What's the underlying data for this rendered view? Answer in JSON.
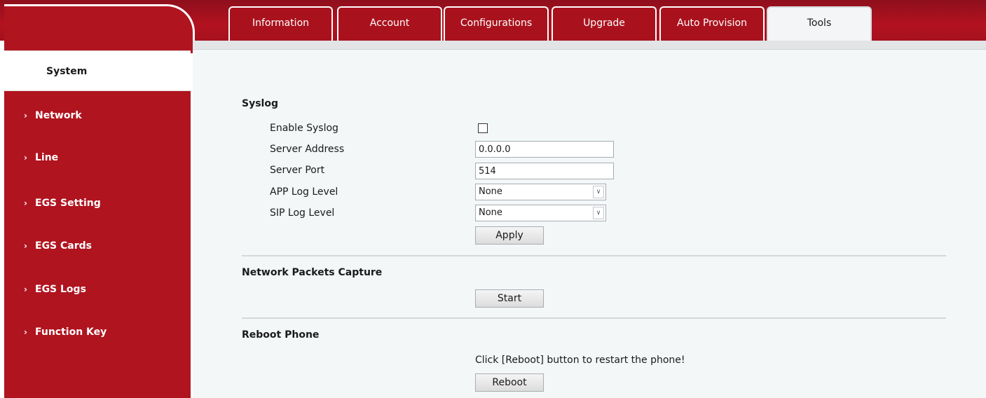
{
  "tabs": [
    {
      "label": "Information",
      "active": false
    },
    {
      "label": "Account",
      "active": false
    },
    {
      "label": "Configurations",
      "active": false
    },
    {
      "label": "Upgrade",
      "active": false
    },
    {
      "label": "Auto Provision",
      "active": false
    },
    {
      "label": "Tools",
      "active": true
    }
  ],
  "sidebar": {
    "active_item": "System",
    "items": [
      {
        "label": "Network",
        "icon": "chevron-right-icon"
      },
      {
        "label": "Line",
        "icon": "chevron-right-icon"
      },
      {
        "label": "EGS Setting",
        "icon": "chevron-right-icon"
      },
      {
        "label": "EGS Cards",
        "icon": "chevron-right-icon"
      },
      {
        "label": "EGS Logs",
        "icon": "chevron-right-icon"
      },
      {
        "label": "Function Key",
        "icon": "chevron-right-icon"
      }
    ]
  },
  "syslog": {
    "title": "Syslog",
    "enable_label": "Enable Syslog",
    "enable_checked": false,
    "server_address_label": "Server Address",
    "server_address_value": "0.0.0.0",
    "server_port_label": "Server Port",
    "server_port_value": "514",
    "app_log_label": "APP Log Level",
    "app_log_value": "None",
    "sip_log_label": "SIP Log Level",
    "sip_log_value": "None",
    "apply_label": "Apply"
  },
  "capture": {
    "title": "Network Packets Capture",
    "start_label": "Start"
  },
  "reboot": {
    "title": "Reboot Phone",
    "note": "Click [Reboot] button to restart the phone!",
    "reboot_label": "Reboot"
  },
  "colors": {
    "brand_red": "#b0141f",
    "main_bg": "#f3f7f8"
  }
}
